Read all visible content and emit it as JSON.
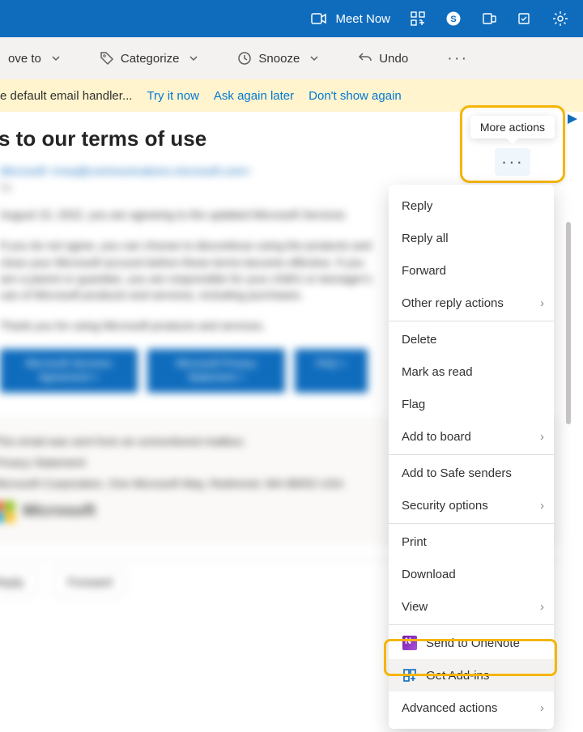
{
  "topbar": {
    "meet_now": "Meet Now"
  },
  "toolbar": {
    "move_to": "ove to",
    "categorize": "Categorize",
    "snooze": "Snooze",
    "undo": "Undo"
  },
  "banner": {
    "msg": "e default email handler...",
    "try": "Try it now",
    "later": "Ask again later",
    "dont": "Don't show again"
  },
  "subject": "s to our terms of use",
  "sender": "Microsoft <msa@communications.microsoft.com>",
  "to": "To:",
  "para1": "August 15, 2022, you are agreeing to the updated Microsoft Services",
  "para2": "If you do not agree, you can choose to discontinue using the products and close your Microsoft account before these terms become effective. If you are a parent or guardian, you are responsible for your child's or teenager's use of Microsoft products and services, including purchases.",
  "para3": "Thank you for using Microsoft products and services.",
  "buttons": {
    "b1": "Microsoft Services Agreement >",
    "b2": "Microsoft Privacy Statement >",
    "b3": "FAQ >"
  },
  "sig1": "This email was sent from an unmonitored mailbox.",
  "sig2": "Privacy Statement",
  "sig3": "Microsoft Corporation, One Microsoft Way, Redmond, WA 98052 USA",
  "sigbrand": "Microsoft",
  "action_reply": "Reply",
  "action_forward": "Forward",
  "more_actions_tooltip": "More actions",
  "menu": {
    "reply": "Reply",
    "reply_all": "Reply all",
    "forward": "Forward",
    "other_reply": "Other reply actions",
    "delete": "Delete",
    "mark_read": "Mark as read",
    "flag": "Flag",
    "add_board": "Add to board",
    "safe_senders": "Add to Safe senders",
    "security": "Security options",
    "print": "Print",
    "download": "Download",
    "view": "View",
    "onenote": "Send to OneNote",
    "addins": "Get Add-ins",
    "advanced": "Advanced actions"
  }
}
